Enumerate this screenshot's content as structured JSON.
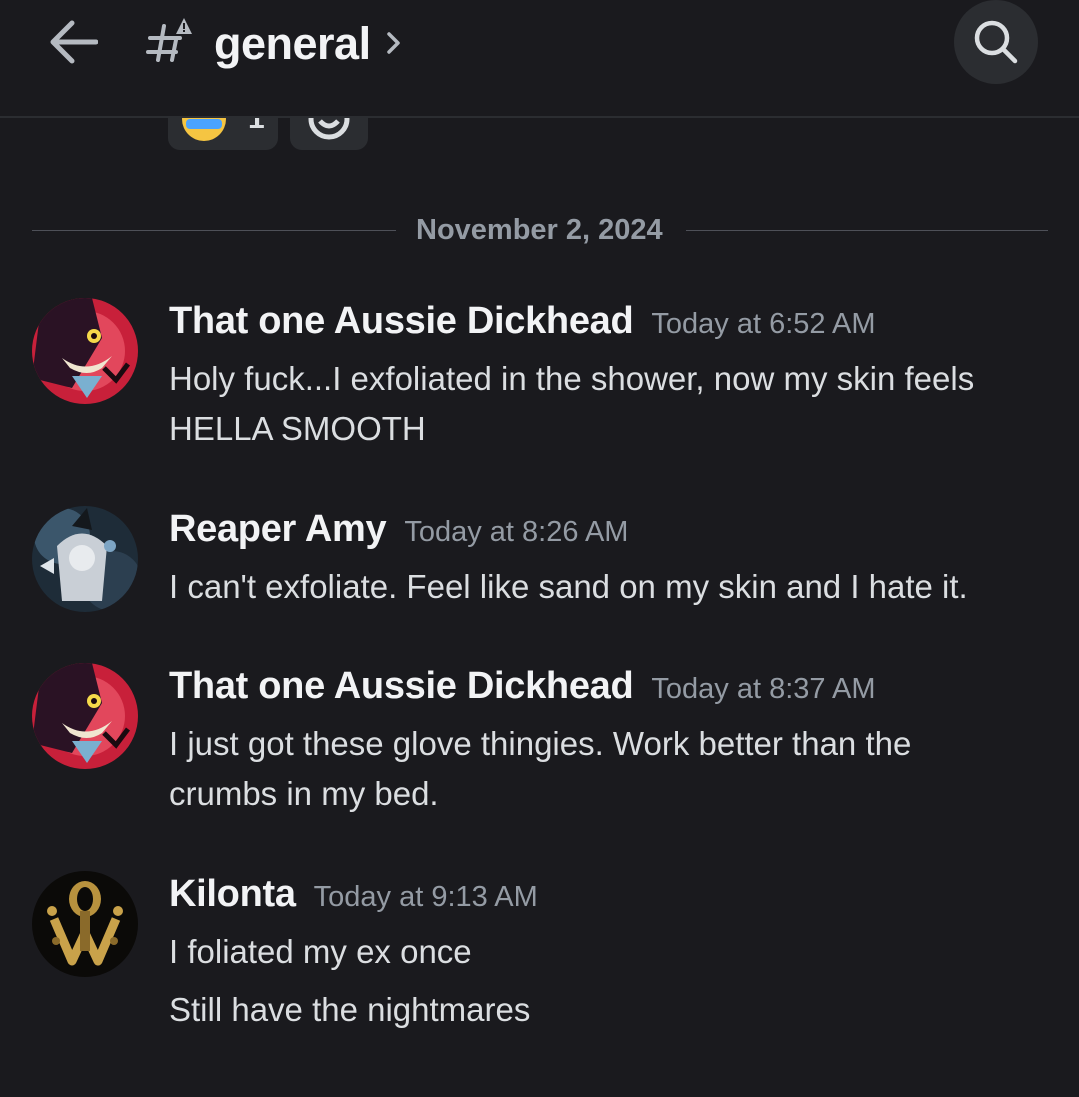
{
  "header": {
    "channel_name": "general",
    "back_icon": "arrow-left-icon",
    "channel_icon": "hash-with-rules-icon",
    "chevron_icon": "chevron-right-icon",
    "search_icon": "search-icon"
  },
  "reactions": [
    {
      "emoji": "laughing-crying-emoji",
      "count": "1"
    },
    {
      "emoji": "add-reaction-icon",
      "count": ""
    }
  ],
  "date_divider": "November 2, 2024",
  "messages": [
    {
      "author": "That one Aussie Dickhead",
      "time": "Today at 6:52 AM",
      "lines": [
        "Holy fuck...I exfoliated in the shower, now my skin feels HELLA SMOOTH"
      ]
    },
    {
      "author": "Reaper Amy",
      "time": "Today at 8:26 AM",
      "lines": [
        "I can't exfoliate. Feel like sand on my skin and I hate it."
      ]
    },
    {
      "author": "That one Aussie Dickhead",
      "time": "Today at 8:37 AM",
      "lines": [
        "I just got these glove thingies. Work better than the crumbs in my bed."
      ]
    },
    {
      "author": "Kilonta",
      "time": "Today at 9:13 AM",
      "lines": [
        "I foliated my ex once",
        "Still have the nightmares"
      ]
    }
  ],
  "colors": {
    "background": "#1a1a1e",
    "username": "#f2f3f5",
    "timestamp": "#949ba4",
    "body_text": "#dbdee1"
  }
}
